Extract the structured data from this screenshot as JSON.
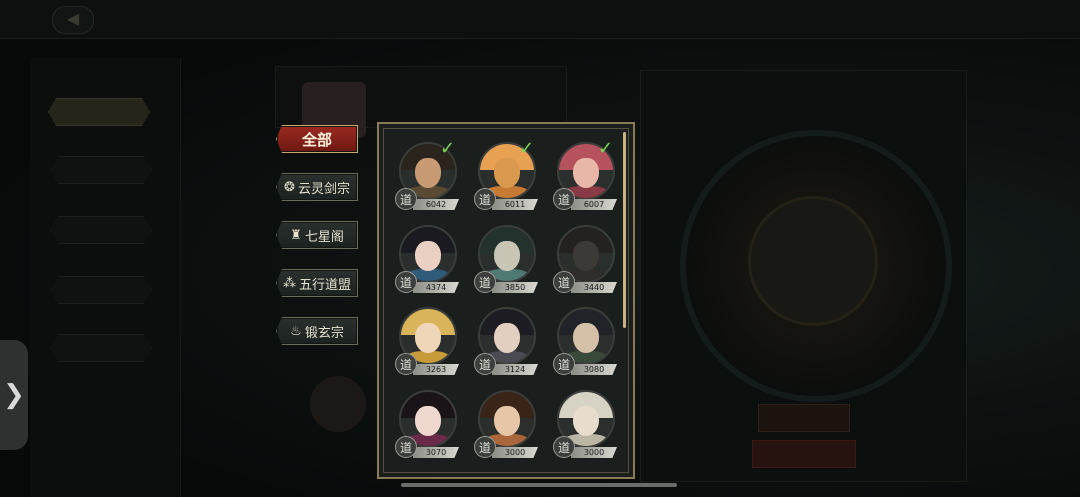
{
  "side_handle_glyph": "❯",
  "filters": [
    {
      "label": "全部",
      "icon": "",
      "icon_name": "",
      "active": true
    },
    {
      "label": "云灵剑宗",
      "icon": "❂",
      "icon_name": "cloud-sword-sect-icon",
      "active": false
    },
    {
      "label": "七星阁",
      "icon": "♜",
      "icon_name": "seven-star-pavilion-icon",
      "active": false
    },
    {
      "label": "五行道盟",
      "icon": "⁂",
      "icon_name": "five-elements-alliance-icon",
      "active": false
    },
    {
      "label": "锻玄宗",
      "icon": "♨",
      "icon_name": "forge-sect-icon",
      "active": false
    }
  ],
  "badge_glyph": "道",
  "characters": [
    {
      "power": "6042",
      "selected": true,
      "skin": "#c79a74",
      "hair": "#2a241c",
      "cloth": "#5a4a34"
    },
    {
      "power": "6011",
      "selected": true,
      "skin": "#d99a4f",
      "hair": "#e8a152",
      "cloth": "#c77a34"
    },
    {
      "power": "6007",
      "selected": true,
      "skin": "#e8b7a8",
      "hair": "#b5525e",
      "cloth": "#8a3a44"
    },
    {
      "power": "4374",
      "selected": false,
      "skin": "#e9d0c2",
      "hair": "#1b1a20",
      "cloth": "#2f5a7a"
    },
    {
      "power": "3850",
      "selected": false,
      "skin": "#c9c5b4",
      "hair": "#24322e",
      "cloth": "#4f7a74"
    },
    {
      "power": "3440",
      "selected": false,
      "skin": "#3d3936",
      "hair": "#242220",
      "cloth": "#302c29"
    },
    {
      "power": "3263",
      "selected": false,
      "skin": "#f0d6b8",
      "hair": "#d9b45a",
      "cloth": "#c79a3a"
    },
    {
      "power": "3124",
      "selected": false,
      "skin": "#e2cfc0",
      "hair": "#1c1c22",
      "cloth": "#4a4a52"
    },
    {
      "power": "3080",
      "selected": false,
      "skin": "#d4c1a8",
      "hair": "#202428",
      "cloth": "#3a4a3a"
    },
    {
      "power": "3070",
      "selected": false,
      "skin": "#f1d8cf",
      "hair": "#1a1418",
      "cloth": "#6a2a4a"
    },
    {
      "power": "3000",
      "selected": false,
      "skin": "#e6c6a6",
      "hair": "#3a2418",
      "cloth": "#a8663a"
    },
    {
      "power": "3000",
      "selected": false,
      "skin": "#e8dccc",
      "hair": "#d6d2c4",
      "cloth": "#bcb6a4"
    }
  ]
}
